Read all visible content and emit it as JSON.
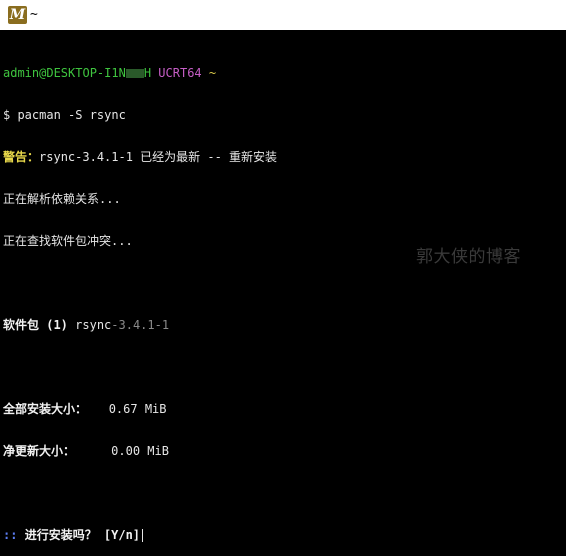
{
  "window": {
    "title": "~",
    "icon": "msys2-m-icon",
    "icon_letter": "M"
  },
  "prompt": {
    "user_host_start": "admin@DESKTOP-I1N",
    "user_host_end": "H",
    "env": "UCRT64",
    "cwd": "~"
  },
  "command": "$ pacman -S rsync",
  "warning_label": "警告：",
  "warning_text": "rsync-3.4.1-1 已经为最新 -- 重新安装",
  "resolving": "正在解析依赖关系...",
  "conflicts": "正在查找软件包冲突...",
  "packages_label": "软件包 (1)",
  "package_name": "rsync",
  "package_version": "-3.4.1-1",
  "total_install_label": "全部安装大小：",
  "total_install_value": "0.67 MiB",
  "net_upgrade_label": "净更新大小：",
  "net_upgrade_value": "0.00 MiB",
  "confirm_marker": "::",
  "confirm_text": "进行安装吗？ [Y/n]",
  "watermark": "郭大侠的博客",
  "colors": {
    "prompt_green": "#3fc43f",
    "env_magenta": "#c65ec6",
    "warning_yellow": "#e8d84a",
    "confirm_blue": "#5b7cf0"
  }
}
